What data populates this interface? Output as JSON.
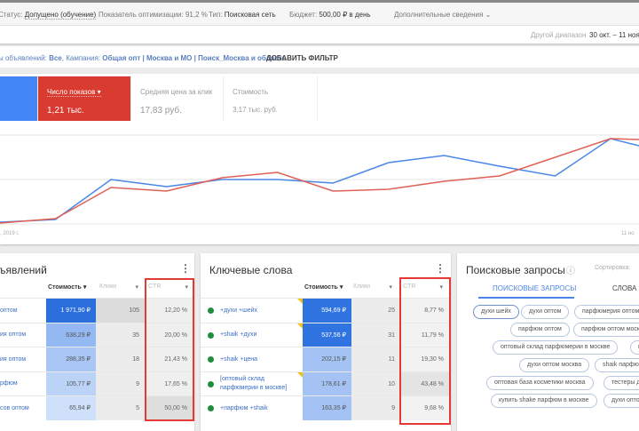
{
  "status_bar": {
    "status_label": "Статус:",
    "status_value": "Допущено (обучение)",
    "opt_label": "Показатель оптимизации:",
    "opt_value": "91,2 %",
    "type_label": "Тип:",
    "type_value": "Поисковая сеть",
    "budget_label": "Бюджет:",
    "budget_value": "500,00 ₽ в день",
    "more_details": "Дополнительные сведения"
  },
  "date_range": {
    "label": "Другой диапазон",
    "value": "30 окт. – 11 ноя"
  },
  "filter": {
    "prefix": "ы объявлений:",
    "ads_value": "Все",
    "campaign_label": "Кампания:",
    "campaign_value": "Общая опт | Москва и МО | Поиск_Москва и область",
    "add_filter": "ДОБАВИТЬ ФИЛЬТР"
  },
  "metrics": [
    {
      "label": "Число показов",
      "value": "1,21 тыс."
    },
    {
      "label": "Средняя цена за клик",
      "value": "17,83 руб."
    },
    {
      "label": "Стоимость",
      "value": "3,17 тыс. руб."
    }
  ],
  "chart_data": {
    "type": "line",
    "x_start_label": ", 2019 г.",
    "x_end_label": "11 но",
    "ylim": [
      0,
      100
    ],
    "series": [
      {
        "name": "blue",
        "color": "#4a86e8",
        "values": [
          2,
          5,
          50,
          42,
          50,
          50,
          46,
          69,
          77,
          65,
          54,
          96,
          88
        ]
      },
      {
        "name": "red",
        "color": "#e06055",
        "values": [
          1,
          6,
          41,
          37,
          52,
          58,
          37,
          39,
          48,
          54,
          75,
          96,
          95
        ]
      }
    ]
  },
  "ads_card": {
    "title": "ъявлений",
    "cols": [
      "Стоимость",
      "Клики",
      "CTR"
    ],
    "rows": [
      {
        "name": "оптом",
        "cost": "1 971,90 ₽",
        "clicks": "105",
        "ctr": "12,20 %"
      },
      {
        "name": "ия оптом",
        "cost": "638,29 ₽",
        "clicks": "35",
        "ctr": "20,00 %"
      },
      {
        "name": "ия оптом",
        "cost": "288,35 ₽",
        "clicks": "18",
        "ctr": "21,43 %"
      },
      {
        "name": "рфюм",
        "cost": "105,77 ₽",
        "clicks": "9",
        "ctr": "17,65 %"
      },
      {
        "name": "сов оптом",
        "cost": "65,94 ₽",
        "clicks": "5",
        "ctr": "50,00 %"
      }
    ]
  },
  "keywords_card": {
    "title": "Ключевые слова",
    "cols": [
      "Стоимость",
      "Клики",
      "CTR"
    ],
    "rows": [
      {
        "name": "+духи +шейх",
        "cost": "594,69 ₽",
        "clicks": "25",
        "ctr": "8,77 %"
      },
      {
        "name": "+shaik +духи",
        "cost": "537,56 ₽",
        "clicks": "31",
        "ctr": "11,79 %"
      },
      {
        "name": "+shaik +цена",
        "cost": "202,15 ₽",
        "clicks": "11",
        "ctr": "19,30 %"
      },
      {
        "name": "[оптовый склад парфюмерии в москве]",
        "cost": "178,61 ₽",
        "clicks": "10",
        "ctr": "43,48 %"
      },
      {
        "name": "+парфюм +shaik",
        "cost": "163,35 ₽",
        "clicks": "9",
        "ctr": "9,68 %"
      }
    ]
  },
  "search_card": {
    "title": "Поисковые запросы",
    "sort_label": "Сортировка:",
    "tabs": [
      "ПОИСКОВЫЕ ЗАПРОСЫ",
      "СЛОВА"
    ],
    "chips": [
      "духи шейх",
      "духи оптом",
      "парфюмерия оптом",
      "парфюм оптом",
      "парфюм оптом москва",
      "оптовый склад парфюмерии в москве",
      "ш",
      "духи оптом москва",
      "shaik парфюм",
      "оптовая база косметики москва",
      "тестеры ду",
      "купить shake парфюм в москве",
      "духи опто"
    ]
  }
}
